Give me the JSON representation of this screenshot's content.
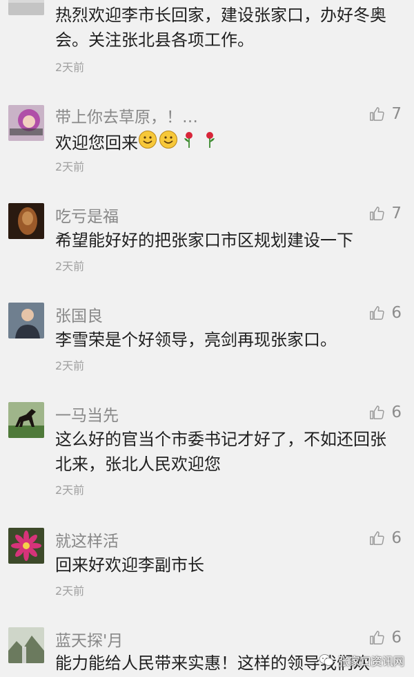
{
  "comments": [
    {
      "name": "",
      "body": "热烈欢迎李市长回家，建设张家口，办好冬奥会。关注张北县各项工作。",
      "time": "2天前",
      "likes": ""
    },
    {
      "name": "带上你去草原，！…",
      "body": "欢迎您回来",
      "body_emojis": [
        "smile-emoji",
        "smile-emoji",
        "rose-emoji",
        "rose-emoji"
      ],
      "time": "2天前",
      "likes": "7"
    },
    {
      "name": "吃亏是福",
      "body": "希望能好好的把张家口市区规划建设一下",
      "time": "2天前",
      "likes": "7"
    },
    {
      "name": "张国良",
      "body": "李雪荣是个好领导，亮剑再现张家口。",
      "time": "2天前",
      "likes": "6"
    },
    {
      "name": "一马当先",
      "body": "这么好的官当个市委书记才好了，不如还回张北来，张北人民欢迎您",
      "time": "2天前",
      "likes": "6"
    },
    {
      "name": "就这样活",
      "body": "回来好欢迎李副市长",
      "time": "2天前",
      "likes": "6"
    },
    {
      "name": "蓝天探'月",
      "body": "能力能给人民带来实惠！这样的领导我们欢",
      "time": "",
      "likes": "6"
    }
  ],
  "watermark": {
    "text": "张家口资讯网"
  },
  "colors": {
    "background": "#f1f1f1",
    "name": "#888888",
    "body": "#1f1f1f",
    "time": "#a0a0a0",
    "like_icon": "#9a9a9a"
  }
}
